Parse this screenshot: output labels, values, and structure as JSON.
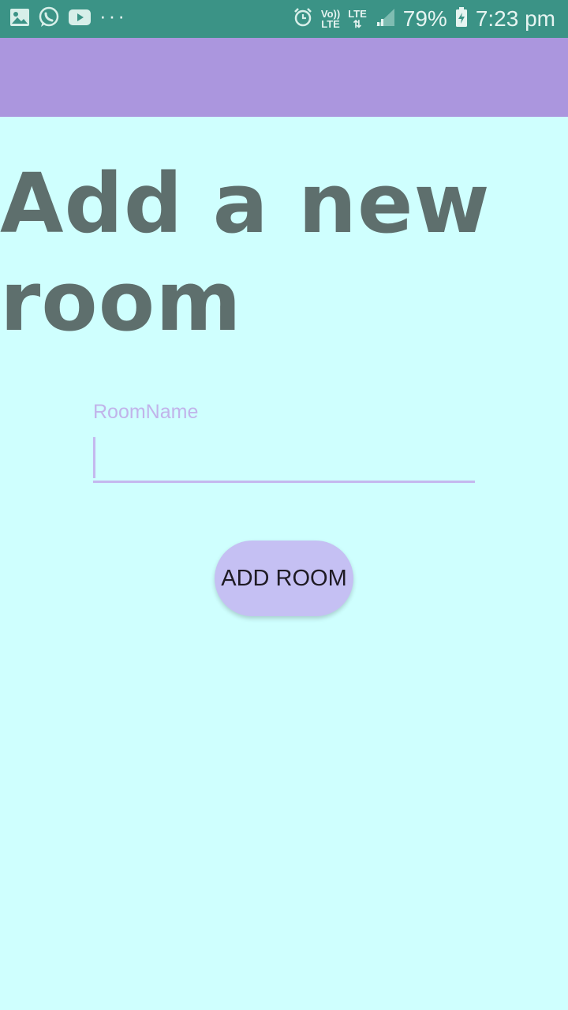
{
  "status_bar": {
    "battery": "79%",
    "time": "7:23 pm",
    "volte_line1": "Vo))",
    "volte_line2": "LTE",
    "lte": "LTE",
    "icons": [
      "gallery-icon",
      "whatsapp-icon",
      "youtube-icon",
      "more-dots-icon",
      "alarm-icon",
      "volte-icon",
      "lte-icon",
      "signal-icon",
      "battery-icon"
    ]
  },
  "page": {
    "title": "Add a new room"
  },
  "room_form": {
    "label": "RoomName",
    "value": "",
    "button_label": "ADD ROOM"
  },
  "colors": {
    "status_bar": "#3b9386",
    "toolbar": "#ab96de",
    "background": "#cffffe",
    "title": "#5e6f6d",
    "accent": "#c4b8ee",
    "button": "#c5c0f3"
  }
}
